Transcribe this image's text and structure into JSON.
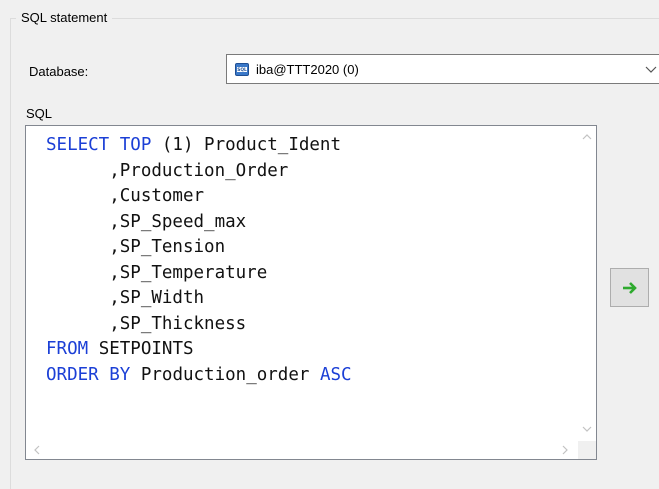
{
  "group": {
    "title": "SQL statement"
  },
  "database": {
    "label": "Database:",
    "value": "iba@TTT2020 (0)",
    "icon": "database-sql-icon"
  },
  "sql": {
    "label": "SQL",
    "lines": [
      [
        {
          "t": "SELECT TOP",
          "kw": true
        },
        {
          "t": " (1) Product_Ident",
          "kw": false
        }
      ],
      [
        {
          "t": "      ,Production_Order",
          "kw": false
        }
      ],
      [
        {
          "t": "      ,Customer",
          "kw": false
        }
      ],
      [
        {
          "t": "      ,SP_Speed_max",
          "kw": false
        }
      ],
      [
        {
          "t": "      ,SP_Tension",
          "kw": false
        }
      ],
      [
        {
          "t": "      ,SP_Temperature",
          "kw": false
        }
      ],
      [
        {
          "t": "      ,SP_Width",
          "kw": false
        }
      ],
      [
        {
          "t": "      ,SP_Thickness",
          "kw": false
        }
      ],
      [
        {
          "t": "FROM",
          "kw": true
        },
        {
          "t": " SETPOINTS",
          "kw": false
        }
      ],
      [
        {
          "t": "ORDER BY",
          "kw": true
        },
        {
          "t": " Production_order ",
          "kw": false
        },
        {
          "t": "ASC",
          "kw": true
        }
      ]
    ]
  },
  "run_button": {
    "icon": "green-arrow-right-icon"
  },
  "colors": {
    "keyword": "#1b3fd6",
    "arrow": "#2eaa2e",
    "background": "#f0f0f0"
  }
}
